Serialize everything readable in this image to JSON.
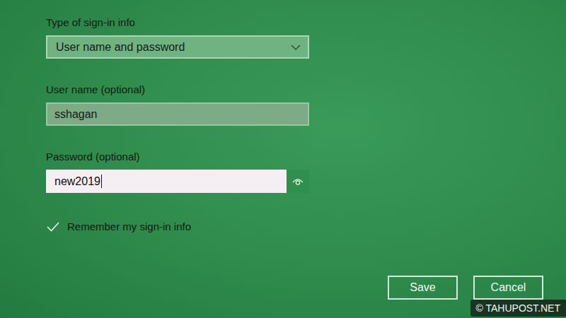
{
  "form": {
    "fields": [
      {
        "kind": "select",
        "label": "Type of sign-in info",
        "value": "User name and password",
        "focused": false
      },
      {
        "kind": "text",
        "label": "User name (optional)",
        "value": "sshagan",
        "focused": false
      },
      {
        "kind": "password",
        "label": "Password (optional)",
        "value": "new2019",
        "focused": true,
        "revealed": true
      }
    ]
  },
  "checkbox": {
    "label": "Remember my sign-in info",
    "checked": true
  },
  "buttons": [
    {
      "label": "Save"
    },
    {
      "label": "Cancel"
    }
  ],
  "watermark": {
    "text": "© TAHUPOST.NET"
  }
}
